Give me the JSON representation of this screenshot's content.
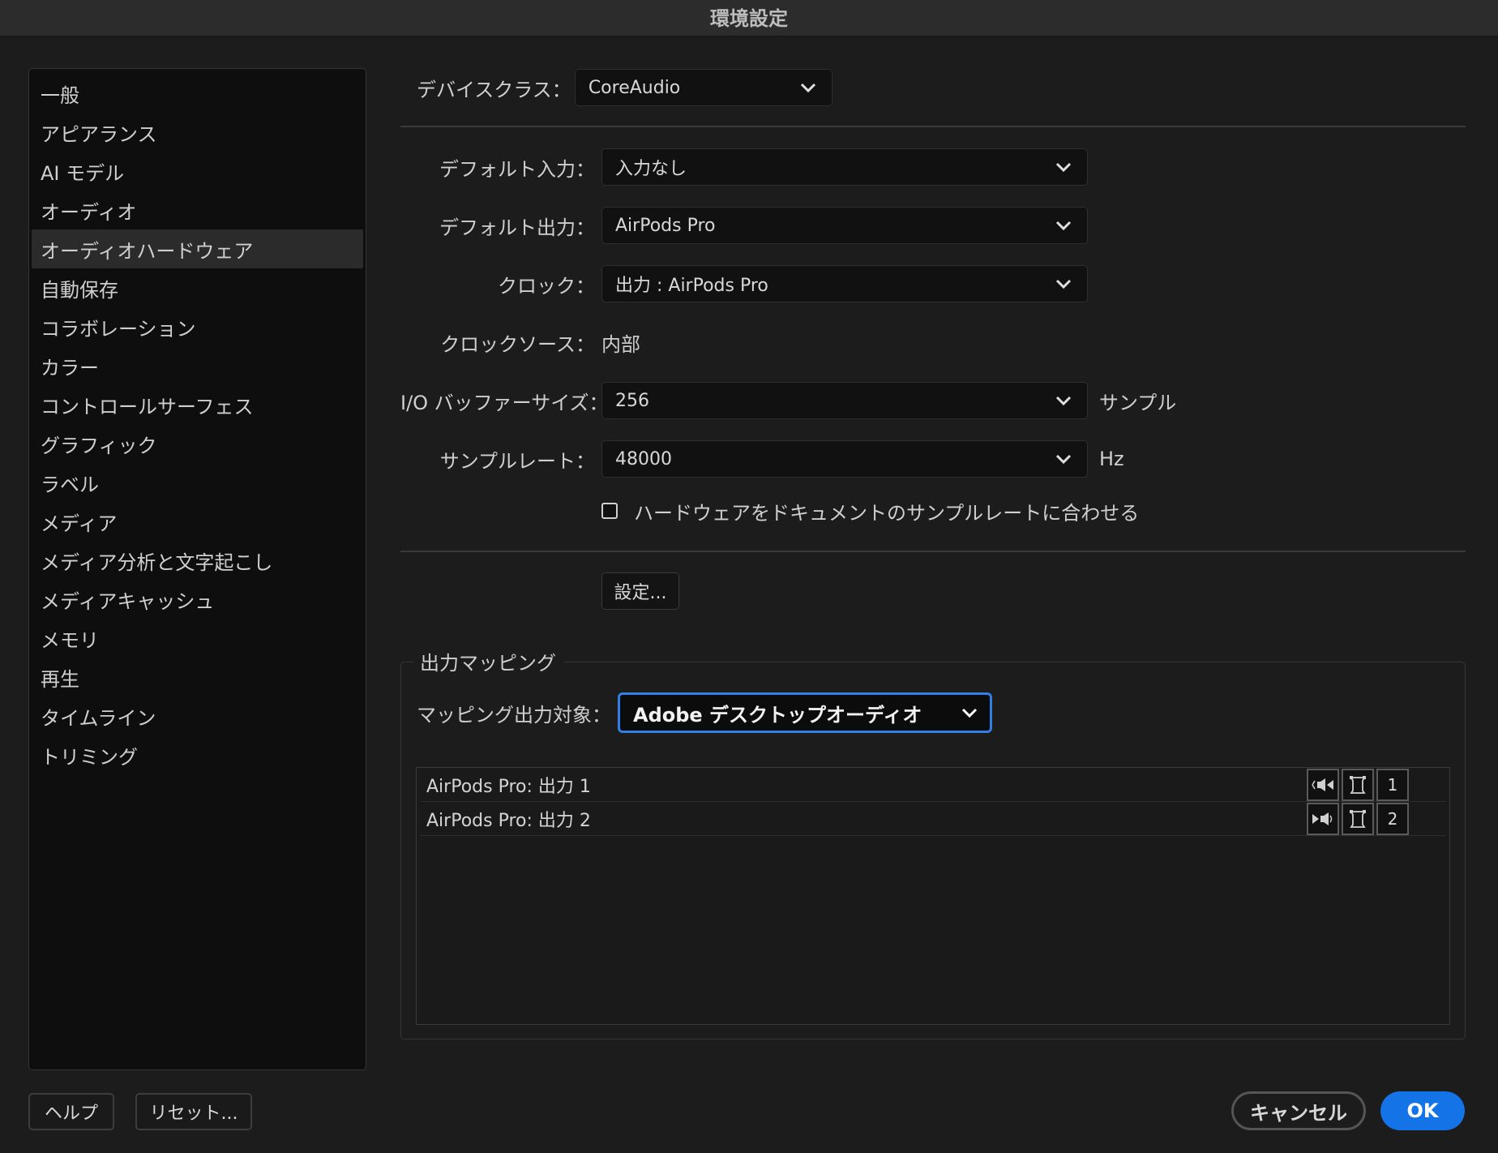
{
  "window": {
    "title": "環境設定"
  },
  "sidebar": {
    "items": [
      {
        "label": "一般"
      },
      {
        "label": "アピアランス"
      },
      {
        "label": "AI モデル"
      },
      {
        "label": "オーディオ"
      },
      {
        "label": "オーディオハードウェア",
        "selected": true
      },
      {
        "label": "自動保存"
      },
      {
        "label": "コラボレーション"
      },
      {
        "label": "カラー"
      },
      {
        "label": "コントロールサーフェス"
      },
      {
        "label": "グラフィック"
      },
      {
        "label": "ラベル"
      },
      {
        "label": "メディア"
      },
      {
        "label": "メディア分析と文字起こし"
      },
      {
        "label": "メディアキャッシュ"
      },
      {
        "label": "メモリ"
      },
      {
        "label": "再生"
      },
      {
        "label": "タイムライン"
      },
      {
        "label": "トリミング"
      }
    ]
  },
  "device_class": {
    "label": "デバイスクラス：",
    "value": "CoreAudio"
  },
  "settings": {
    "default_input": {
      "label": "デフォルト入力：",
      "value": "入力なし"
    },
    "default_output": {
      "label": "デフォルト出力：",
      "value": "AirPods Pro"
    },
    "clock": {
      "label": "クロック：",
      "value": "出力 : AirPods Pro"
    },
    "clock_source": {
      "label": "クロックソース：",
      "value": "内部"
    },
    "buffer_size": {
      "label": "I/O バッファーサイズ：",
      "value": "256",
      "unit": "サンプル"
    },
    "sample_rate": {
      "label": "サンプルレート：",
      "value": "48000",
      "unit": "Hz"
    },
    "match_rate": {
      "label": "ハードウェアをドキュメントのサンプルレートに合わせる",
      "checked": false
    },
    "settings_button": "設定..."
  },
  "output_mapping": {
    "group_title": "出力マッピング",
    "target_label": "マッピング出力対象：",
    "target_value": "Adobe デスクトップオーディオ",
    "rows": [
      {
        "name": "AirPods Pro: 出力 1",
        "channel": "1",
        "icon": "speaker-left-icon"
      },
      {
        "name": "AirPods Pro: 出力 2",
        "channel": "2",
        "icon": "speaker-right-icon"
      }
    ]
  },
  "footer": {
    "help": "ヘルプ",
    "reset": "リセット...",
    "cancel": "キャンセル",
    "ok": "OK"
  },
  "colors": {
    "accent": "#1473e6",
    "focus_ring": "#2f7fe6",
    "background": "#1c1c1c"
  }
}
